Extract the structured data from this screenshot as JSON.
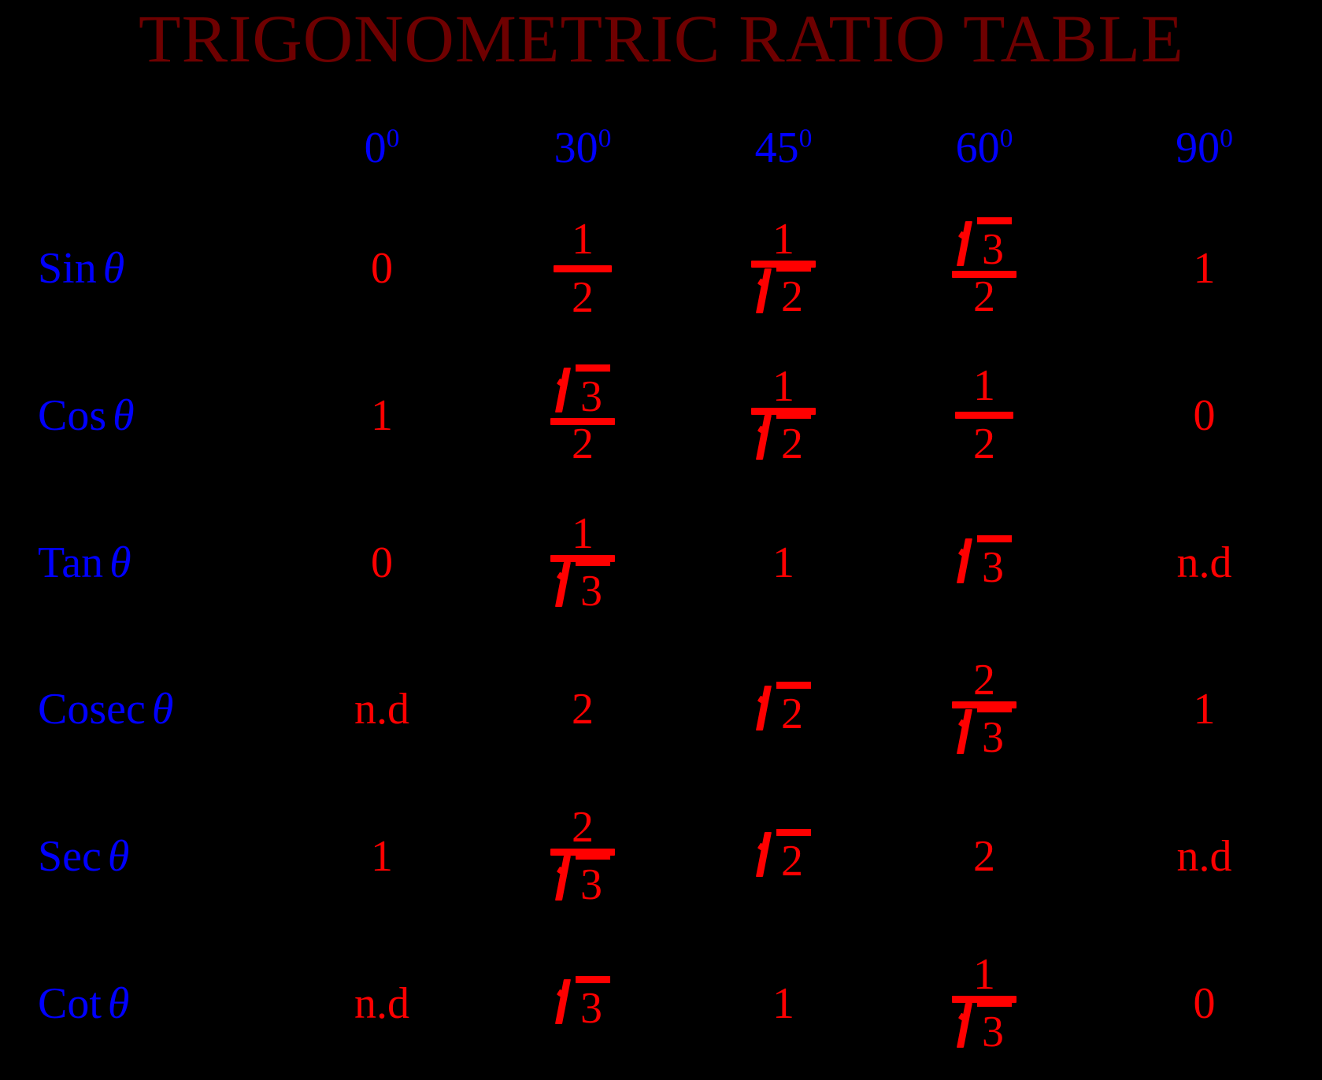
{
  "title": "TRIGONOMETRIC RATIO TABLE",
  "colors": {
    "background": "#000000",
    "title": "#6e0000",
    "label": "#0000ff",
    "value": "#ff0000"
  },
  "table": {
    "corner_label": "",
    "columns": [
      {
        "base": "0",
        "sup": "0"
      },
      {
        "base": "30",
        "sup": "0"
      },
      {
        "base": "45",
        "sup": "0"
      },
      {
        "base": "60",
        "sup": "0"
      },
      {
        "base": "90",
        "sup": "0"
      }
    ],
    "rows": [
      {
        "label": "Sin",
        "symbol": "θ",
        "cells": [
          {
            "kind": "plain",
            "text": "0"
          },
          {
            "kind": "fraction",
            "num": "1",
            "den": "2"
          },
          {
            "kind": "fraction",
            "num": "1",
            "den_sqrt": "2"
          },
          {
            "kind": "fraction",
            "num_sqrt": "3",
            "den": "2"
          },
          {
            "kind": "plain",
            "text": "1"
          }
        ]
      },
      {
        "label": "Cos",
        "symbol": "θ",
        "cells": [
          {
            "kind": "plain",
            "text": "1"
          },
          {
            "kind": "fraction",
            "num_sqrt": "3",
            "den": "2"
          },
          {
            "kind": "fraction",
            "num": "1",
            "den_sqrt": "2"
          },
          {
            "kind": "fraction",
            "num": "1",
            "den": "2"
          },
          {
            "kind": "plain",
            "text": "0"
          }
        ]
      },
      {
        "label": "Tan",
        "symbol": "θ",
        "cells": [
          {
            "kind": "plain",
            "text": "0"
          },
          {
            "kind": "fraction",
            "num": "1",
            "den_sqrt": "3"
          },
          {
            "kind": "plain",
            "text": "1"
          },
          {
            "kind": "sqrt",
            "text": "3"
          },
          {
            "kind": "plain",
            "text": "n.d"
          }
        ]
      },
      {
        "label": "Cosec",
        "symbol": "θ",
        "cells": [
          {
            "kind": "plain",
            "text": "n.d"
          },
          {
            "kind": "plain",
            "text": "2"
          },
          {
            "kind": "sqrt",
            "text": "2"
          },
          {
            "kind": "fraction",
            "num": "2",
            "den_sqrt": "3"
          },
          {
            "kind": "plain",
            "text": "1"
          }
        ]
      },
      {
        "label": "Sec",
        "symbol": "θ",
        "cells": [
          {
            "kind": "plain",
            "text": "1"
          },
          {
            "kind": "fraction",
            "num": "2",
            "den_sqrt": "3"
          },
          {
            "kind": "sqrt",
            "text": "2"
          },
          {
            "kind": "plain",
            "text": "2"
          },
          {
            "kind": "plain",
            "text": "n.d"
          }
        ]
      },
      {
        "label": "Cot",
        "symbol": "θ",
        "cells": [
          {
            "kind": "plain",
            "text": "n.d"
          },
          {
            "kind": "sqrt",
            "text": "3"
          },
          {
            "kind": "plain",
            "text": "1"
          },
          {
            "kind": "fraction",
            "num": "1",
            "den_sqrt": "3"
          },
          {
            "kind": "plain",
            "text": "0"
          }
        ]
      }
    ]
  }
}
